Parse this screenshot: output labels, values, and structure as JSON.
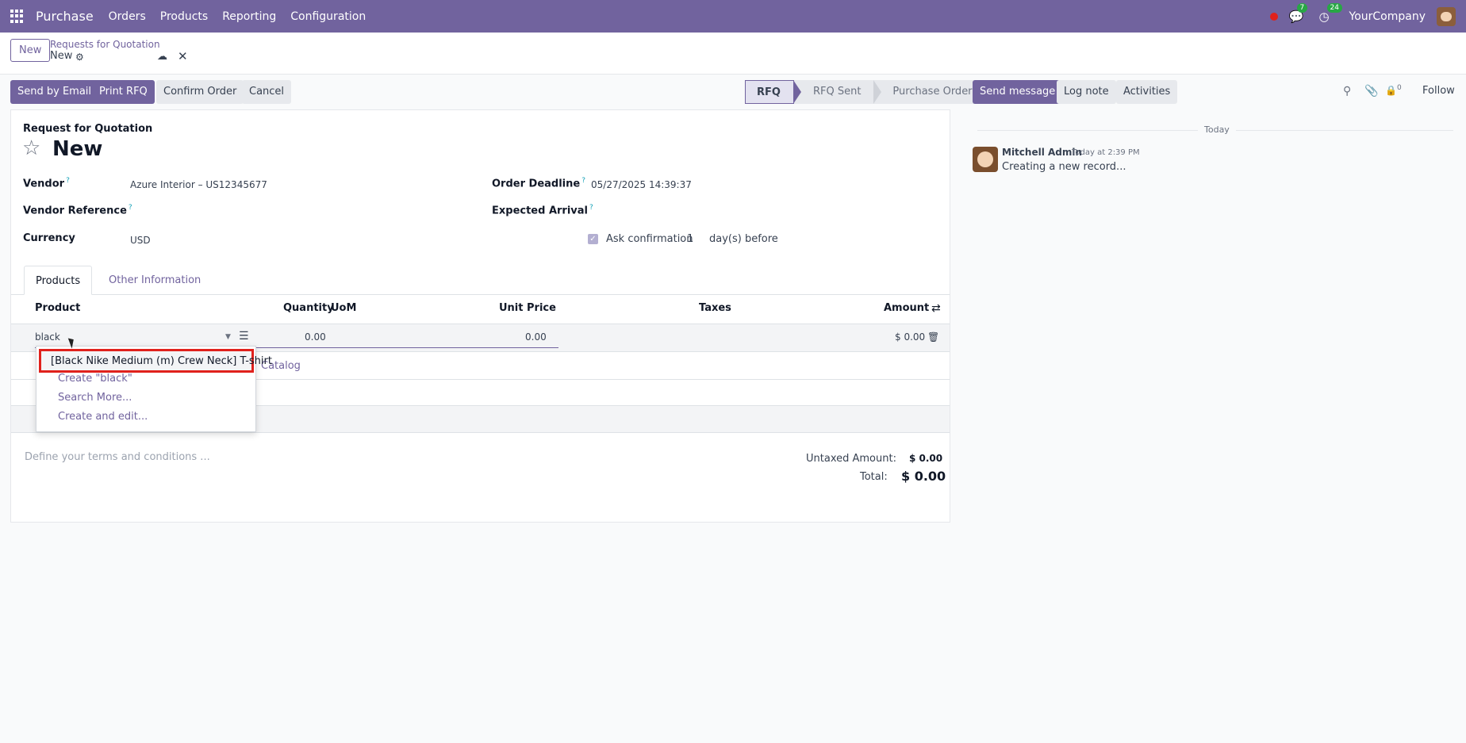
{
  "navbar": {
    "app_name": "Purchase",
    "menus": [
      "Orders",
      "Products",
      "Reporting",
      "Configuration"
    ],
    "messages_count": "7",
    "activities_count": "24",
    "company": "YourCompany"
  },
  "control_panel": {
    "new_label": "New",
    "breadcrumb_parent": "Requests for Quotation",
    "breadcrumb_current": "New"
  },
  "actions": {
    "send_by_email": "Send by Email",
    "print_rfq": "Print RFQ",
    "confirm_order": "Confirm Order",
    "cancel": "Cancel"
  },
  "status_stages": [
    "RFQ",
    "RFQ Sent",
    "Purchase Order"
  ],
  "form": {
    "doc_type": "Request for Quotation",
    "title": "New",
    "vendor_label": "Vendor",
    "vendor_value": "Azure Interior – US12345677",
    "vendor_ref_label": "Vendor Reference",
    "currency_label": "Currency",
    "currency_value": "USD",
    "order_deadline_label": "Order Deadline",
    "order_deadline_value": "05/27/2025 14:39:37",
    "expected_arrival_label": "Expected Arrival",
    "ask_confirmation_label": "Ask confirmation",
    "ask_confirmation_days": "1",
    "days_before": "day(s) before",
    "help_mark": "?"
  },
  "tabs": [
    "Products",
    "Other Information"
  ],
  "table": {
    "headers": {
      "product": "Product",
      "quantity": "Quantity",
      "uom": "UoM",
      "unit_price": "Unit Price",
      "taxes": "Taxes",
      "amount": "Amount"
    },
    "edit_row": {
      "product": "black",
      "quantity": "0.00",
      "unit_price": "0.00",
      "amount": "$ 0.00"
    },
    "catalog_link": "Catalog"
  },
  "autocomplete": {
    "highlighted": "[Black Nike Medium (m) Crew Neck] T-shirt",
    "items": [
      "Create \"black\"",
      "Search More...",
      "Create and edit..."
    ]
  },
  "totals": {
    "terms_placeholder": "Define your terms and conditions ...",
    "untaxed_label": "Untaxed Amount:",
    "untaxed_value": "$ 0.00",
    "total_label": "Total:",
    "total_value": "$ 0.00"
  },
  "chatter": {
    "send_message": "Send message",
    "log_note": "Log note",
    "activities": "Activities",
    "followers_count": "0",
    "follow": "Follow",
    "date_separator": "Today",
    "message": {
      "author": "Mitchell Admin",
      "time": "Today at 2:39 PM",
      "body": "Creating a new record..."
    }
  },
  "colors": {
    "brand": "#71639e",
    "highlight_border": "#e0211c",
    "badge": "#28a745"
  }
}
